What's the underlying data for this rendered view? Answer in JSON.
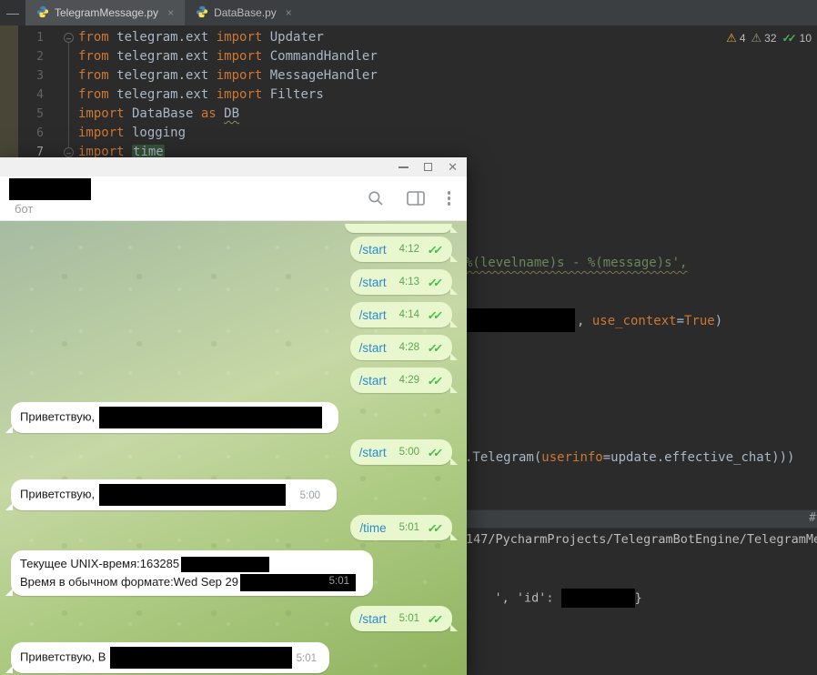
{
  "ide": {
    "menu_glyph": "—",
    "tabs": [
      {
        "label": "TelegramMessage.py",
        "close_glyph": "×",
        "active": true
      },
      {
        "label": "DataBase.py",
        "close_glyph": "×",
        "active": false
      }
    ],
    "inspections": [
      {
        "type": "warning",
        "glyph": "⚠",
        "count": "4"
      },
      {
        "type": "weak-warning",
        "glyph": "⚠",
        "count": "32"
      },
      {
        "type": "ok",
        "glyph": "✓✓",
        "count": "10"
      }
    ],
    "lines": [
      {
        "num": "1",
        "fold": true,
        "tokens": [
          [
            "kw",
            "from"
          ],
          [
            "pl",
            " telegram.ext "
          ],
          [
            "kw",
            "import"
          ],
          [
            "pl",
            " Updater"
          ]
        ]
      },
      {
        "num": "2",
        "fold": false,
        "tokens": [
          [
            "kw",
            "from"
          ],
          [
            "pl",
            " telegram.ext "
          ],
          [
            "kw",
            "import"
          ],
          [
            "pl",
            " CommandHandler"
          ]
        ]
      },
      {
        "num": "3",
        "fold": false,
        "tokens": [
          [
            "kw",
            "from"
          ],
          [
            "pl",
            " telegram.ext "
          ],
          [
            "kw",
            "import"
          ],
          [
            "pl",
            " MessageHandler"
          ]
        ]
      },
      {
        "num": "4",
        "fold": false,
        "tokens": [
          [
            "kw",
            "from"
          ],
          [
            "pl",
            " telegram.ext "
          ],
          [
            "kw",
            "import"
          ],
          [
            "pl",
            " Filters"
          ]
        ]
      },
      {
        "num": "5",
        "fold": false,
        "tokens": [
          [
            "kw",
            "import"
          ],
          [
            "pl",
            " DataBase "
          ],
          [
            "kw",
            "as"
          ],
          [
            "pl",
            " "
          ],
          [
            "err",
            "DB"
          ]
        ]
      },
      {
        "num": "6",
        "fold": false,
        "tokens": [
          [
            "kw",
            "import"
          ],
          [
            "pl",
            " logging"
          ]
        ]
      },
      {
        "num": "7",
        "fold": true,
        "tokens": [
          [
            "kw",
            "import"
          ],
          [
            "pl",
            " "
          ],
          [
            "hl",
            "time"
          ]
        ]
      }
    ],
    "fragments": {
      "string_line": "%(levelname)s - %(message)s',",
      "use_context_tokens": [
        [
          "pl",
          ", "
        ],
        [
          "param",
          "use_context"
        ],
        [
          "op",
          "="
        ],
        [
          "kw",
          "True"
        ],
        [
          "pl",
          ")"
        ]
      ],
      "telegram_call_tokens": [
        [
          "pl",
          ".Telegram("
        ],
        [
          "param",
          "userinfo"
        ],
        [
          "pl",
          "=update.effective_chat)))"
        ]
      ],
      "console_gear": "#",
      "console_path": "147/PycharmProjects/TelegramBotEngine/TelegramMes",
      "console_id_prefix": "', 'id': ",
      "console_id_suffix": "}"
    }
  },
  "telegram": {
    "titlebar": {
      "close_glyph": "✕"
    },
    "header": {
      "subtitle": "бот"
    },
    "checks_glyph": "✓✓",
    "messages": [
      {
        "kind": "sliver"
      },
      {
        "kind": "out",
        "text": "/start",
        "time": "4:12"
      },
      {
        "kind": "out",
        "text": "/start",
        "time": "4:13"
      },
      {
        "kind": "out",
        "text": "/start",
        "time": "4:14"
      },
      {
        "kind": "out",
        "text": "/start",
        "time": "4:28"
      },
      {
        "kind": "out",
        "text": "/start",
        "time": "4:29"
      },
      {
        "kind": "in",
        "text": "Приветствую,",
        "time": ""
      },
      {
        "kind": "out",
        "text": "/start",
        "time": "5:00"
      },
      {
        "kind": "in",
        "text": "Приветствую,",
        "time": "5:00"
      },
      {
        "kind": "out",
        "text": "/time",
        "time": "5:01"
      },
      {
        "kind": "in2",
        "line1": "Текущее UNIX-время:163285",
        "line2": "Время в обычном формате:Wed Sep 29",
        "time": "5:01"
      },
      {
        "kind": "out",
        "text": "/start",
        "time": "5:01"
      },
      {
        "kind": "in",
        "text": "Приветствую, В",
        "time": "5:01"
      }
    ],
    "colors": {
      "out_bubble": "#e8f7cd",
      "link": "#2f89ce",
      "time_green": "#59a84f",
      "check_green": "#44bb44",
      "in_time_gray": "#9aa0a5"
    }
  }
}
